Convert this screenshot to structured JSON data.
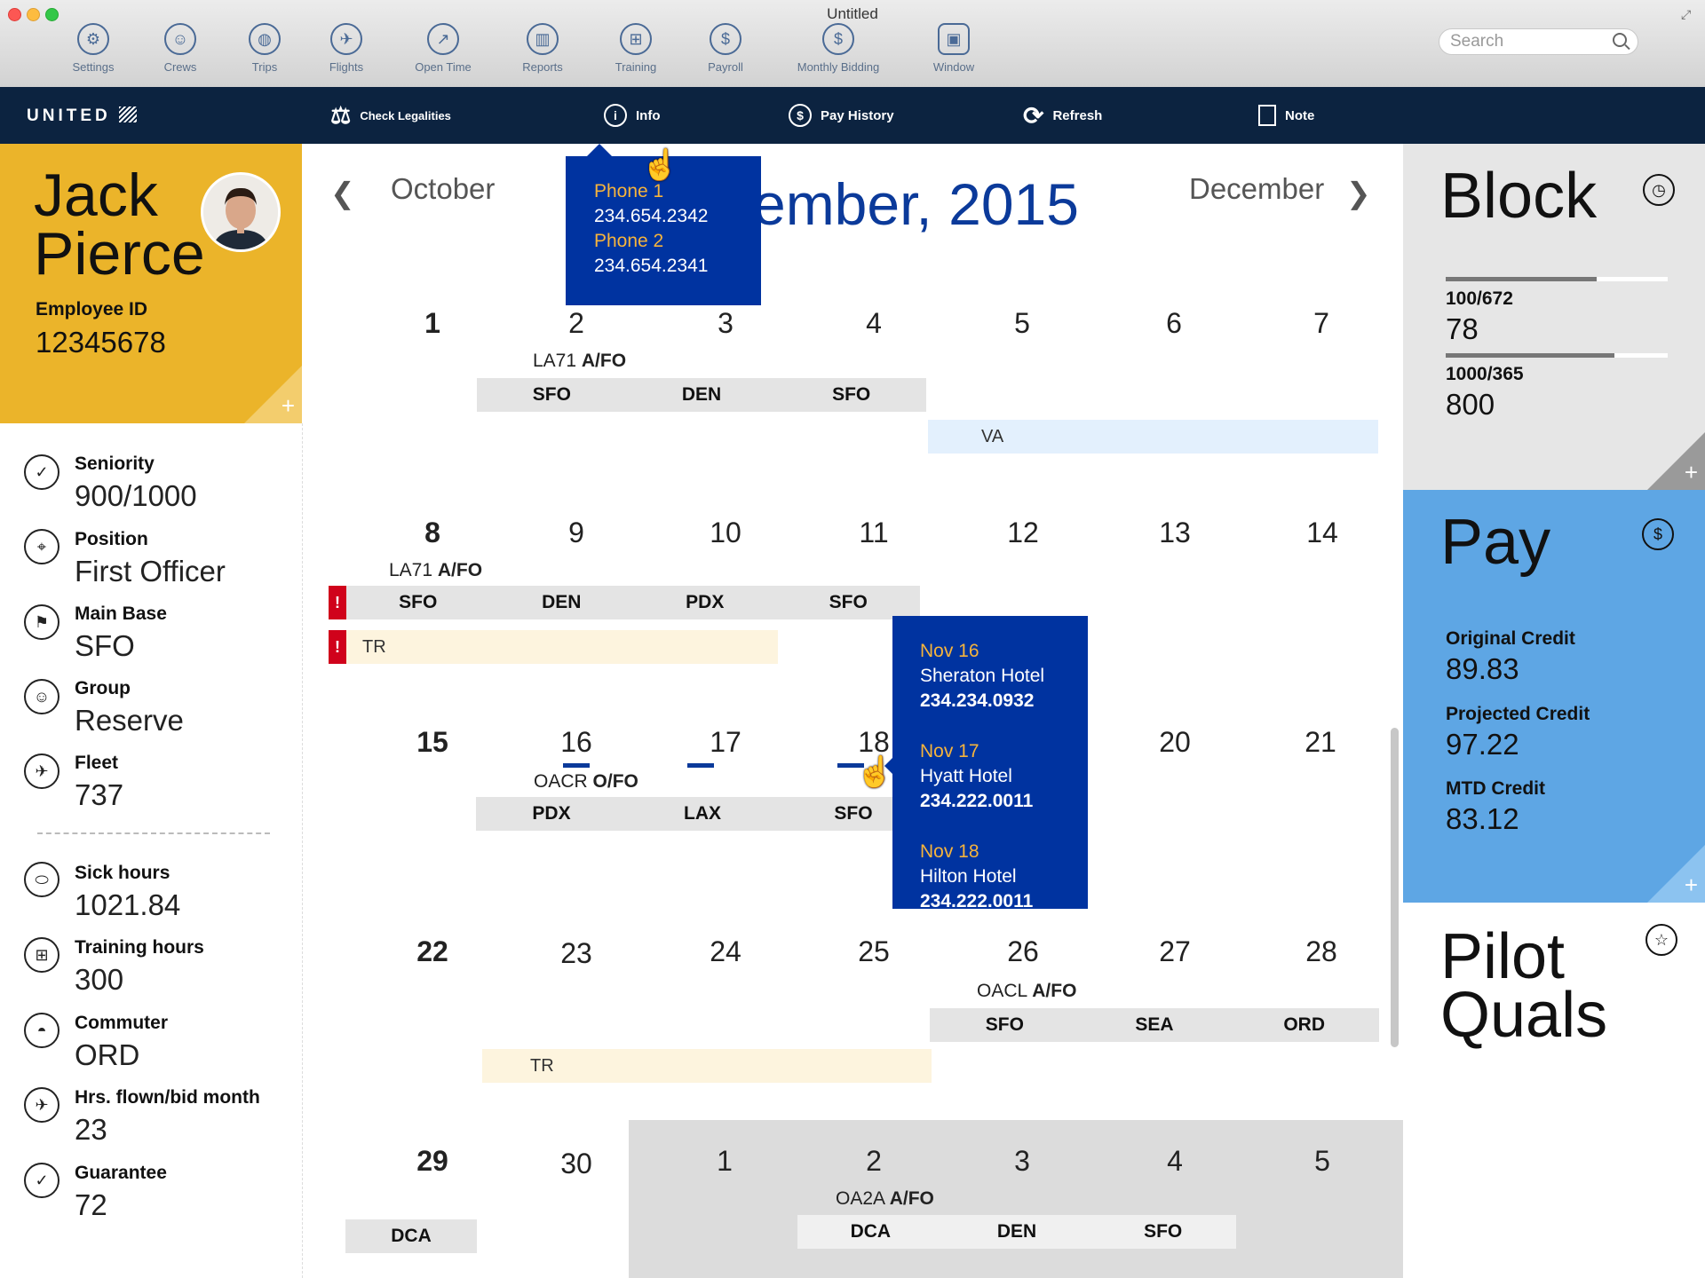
{
  "window": {
    "title": "Untitled"
  },
  "toolbar": {
    "items": [
      {
        "label": "Settings",
        "icon": "gear-icon"
      },
      {
        "label": "Crews",
        "icon": "crew-icon"
      },
      {
        "label": "Trips",
        "icon": "globe-icon"
      },
      {
        "label": "Flights",
        "icon": "plane-icon"
      },
      {
        "label": "Open Time",
        "icon": "open-time-icon"
      },
      {
        "label": "Reports",
        "icon": "reports-icon"
      },
      {
        "label": "Training",
        "icon": "training-icon"
      },
      {
        "label": "Payroll",
        "icon": "payroll-icon"
      },
      {
        "label": "Monthly Bidding",
        "icon": "bidding-icon"
      },
      {
        "label": "Window",
        "icon": "window-icon"
      }
    ],
    "search_placeholder": "Search"
  },
  "nav": {
    "logo": "UNITED",
    "items": [
      {
        "label": "Check Legalities",
        "icon": "scales-icon"
      },
      {
        "label": "Info",
        "icon": "info-icon"
      },
      {
        "label": "Pay History",
        "icon": "pay-history-icon"
      },
      {
        "label": "Refresh",
        "icon": "refresh-icon"
      },
      {
        "label": "Note",
        "icon": "note-icon"
      }
    ]
  },
  "profile": {
    "first_name": "Jack",
    "last_name": "Pierce",
    "employee_id_label": "Employee ID",
    "employee_id": "12345678"
  },
  "stats": [
    {
      "label": "Seniority",
      "value": "900/1000",
      "icon": "ribbon-icon"
    },
    {
      "label": "Position",
      "value": "First Officer",
      "icon": "crosshair-icon"
    },
    {
      "label": "Main Base",
      "value": "SFO",
      "icon": "flag-icon"
    },
    {
      "label": "Group",
      "value": "Reserve",
      "icon": "group-icon"
    },
    {
      "label": "Fleet",
      "value": "737",
      "icon": "plane-icon"
    },
    {
      "label": "Sick hours",
      "value": "1021.84",
      "icon": "pill-icon"
    },
    {
      "label": "Training hours",
      "value": "300",
      "icon": "training-icon"
    },
    {
      "label": "Commuter",
      "value": "ORD",
      "icon": "commuter-icon"
    },
    {
      "label": "Hrs. flown/bid month",
      "value": "23",
      "icon": "stopwatch-icon"
    },
    {
      "label": "Guarantee",
      "value": "72",
      "icon": "check-icon"
    }
  ],
  "calendar": {
    "prev_month": "October",
    "next_month": "December",
    "title": "ember, 2015",
    "weeks": [
      [
        "1",
        "2",
        "3",
        "4",
        "5",
        "6",
        "7"
      ],
      [
        "8",
        "9",
        "10",
        "11",
        "12",
        "13",
        "14"
      ],
      [
        "15",
        "16",
        "17",
        "18",
        "19",
        "20",
        "21"
      ],
      [
        "22",
        "23",
        "24",
        "25",
        "26",
        "27",
        "28"
      ],
      [
        "29",
        "30",
        "1",
        "2",
        "3",
        "4",
        "5"
      ]
    ],
    "trips": [
      {
        "code": "LA71",
        "role": "A/FO",
        "legs": [
          "SFO",
          "DEN",
          "SFO"
        ]
      },
      {
        "code": "LA71",
        "role": "A/FO",
        "legs": [
          "SFO",
          "DEN",
          "PDX",
          "SFO"
        ]
      },
      {
        "code": "OACR",
        "role": "O/FO",
        "legs": [
          "PDX",
          "LAX",
          "SFO"
        ]
      },
      {
        "code": "OACL",
        "role": "A/FO",
        "legs": [
          "SFO",
          "SEA",
          "ORD"
        ]
      },
      {
        "code": "OA2A",
        "role": "A/FO",
        "legs": [
          "DCA",
          "DEN",
          "SFO"
        ]
      }
    ],
    "extra_leg_week5": "DCA",
    "events": {
      "va": "VA",
      "tr1": "TR",
      "tr2": "TR"
    },
    "alert_mark": "!"
  },
  "info_popover": {
    "phone1_label": "Phone 1",
    "phone1": "234.654.2342",
    "phone2_label": "Phone 2",
    "phone2": "234.654.2341"
  },
  "hotel_popover": [
    {
      "date": "Nov 16",
      "hotel": "Sheraton Hotel",
      "phone": "234.234.0932"
    },
    {
      "date": "Nov 17",
      "hotel": "Hyatt Hotel",
      "phone": "234.222.0011"
    },
    {
      "date": "Nov 18",
      "hotel": "Hilton Hotel",
      "phone": "234.222.0011"
    }
  ],
  "block": {
    "title": "Block",
    "rows": [
      {
        "label": "100/672",
        "value": "78",
        "progress": 0.68
      },
      {
        "label": "1000/365",
        "value": "800",
        "progress": 0.76
      }
    ]
  },
  "pay": {
    "title": "Pay",
    "rows": [
      {
        "label": "Original Credit",
        "value": "89.83"
      },
      {
        "label": "Projected Credit",
        "value": "97.22"
      },
      {
        "label": "MTD Credit",
        "value": "83.12"
      }
    ]
  },
  "quals": {
    "title_line1": "Pilot",
    "title_line2": "Quals"
  },
  "plus": "+",
  "colors": {
    "navy": "#0c2340",
    "gold": "#ebb42a",
    "blue": "#0033a0",
    "pay_blue": "#5ea6e4"
  }
}
